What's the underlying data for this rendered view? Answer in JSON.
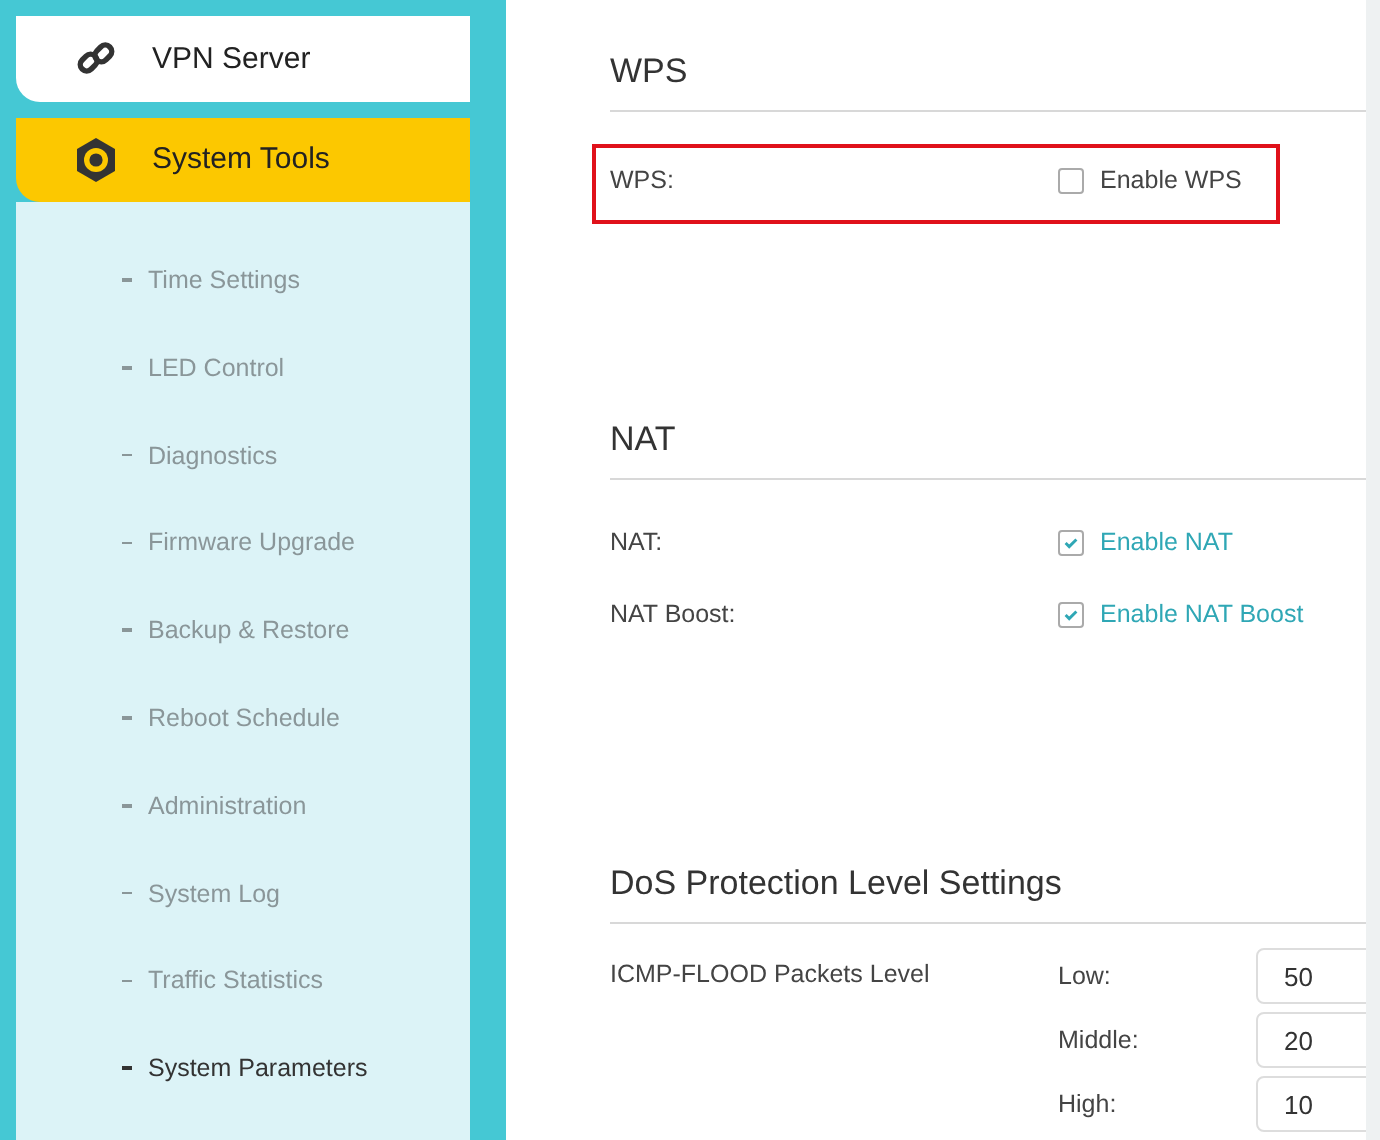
{
  "sidebar": {
    "items": [
      {
        "label": "VPN Server",
        "selected": false
      },
      {
        "label": "System Tools",
        "selected": true,
        "expanded": true,
        "children": [
          {
            "label": "Time Settings",
            "selected": false
          },
          {
            "label": "LED Control",
            "selected": false
          },
          {
            "label": "Diagnostics",
            "selected": false
          },
          {
            "label": "Firmware Upgrade",
            "selected": false
          },
          {
            "label": "Backup & Restore",
            "selected": false
          },
          {
            "label": "Reboot Schedule",
            "selected": false
          },
          {
            "label": "Administration",
            "selected": false
          },
          {
            "label": "System Log",
            "selected": false
          },
          {
            "label": "Traffic Statistics",
            "selected": false
          },
          {
            "label": "System Parameters",
            "selected": true
          }
        ]
      }
    ]
  },
  "sections": [
    {
      "title": "WPS",
      "rows": [
        {
          "kind": "checkbox",
          "label": "WPS:",
          "option": "Enable WPS",
          "checked": false,
          "highlighted": true
        }
      ]
    },
    {
      "title": "NAT",
      "rows": [
        {
          "kind": "checkbox",
          "label": "NAT:",
          "option": "Enable NAT",
          "checked": true,
          "highlighted": false
        },
        {
          "kind": "checkbox",
          "label": "NAT Boost:",
          "option": "Enable NAT Boost",
          "checked": true,
          "highlighted": false
        }
      ]
    },
    {
      "title": "DoS Protection Level Settings",
      "rows": [
        {
          "kind": "levels",
          "label": "ICMP-FLOOD Packets Level",
          "fields": [
            {
              "label": "Low:",
              "value": "50"
            },
            {
              "label": "Middle:",
              "value": "20"
            },
            {
              "label": "High:",
              "value": "10"
            }
          ]
        }
      ]
    }
  ]
}
